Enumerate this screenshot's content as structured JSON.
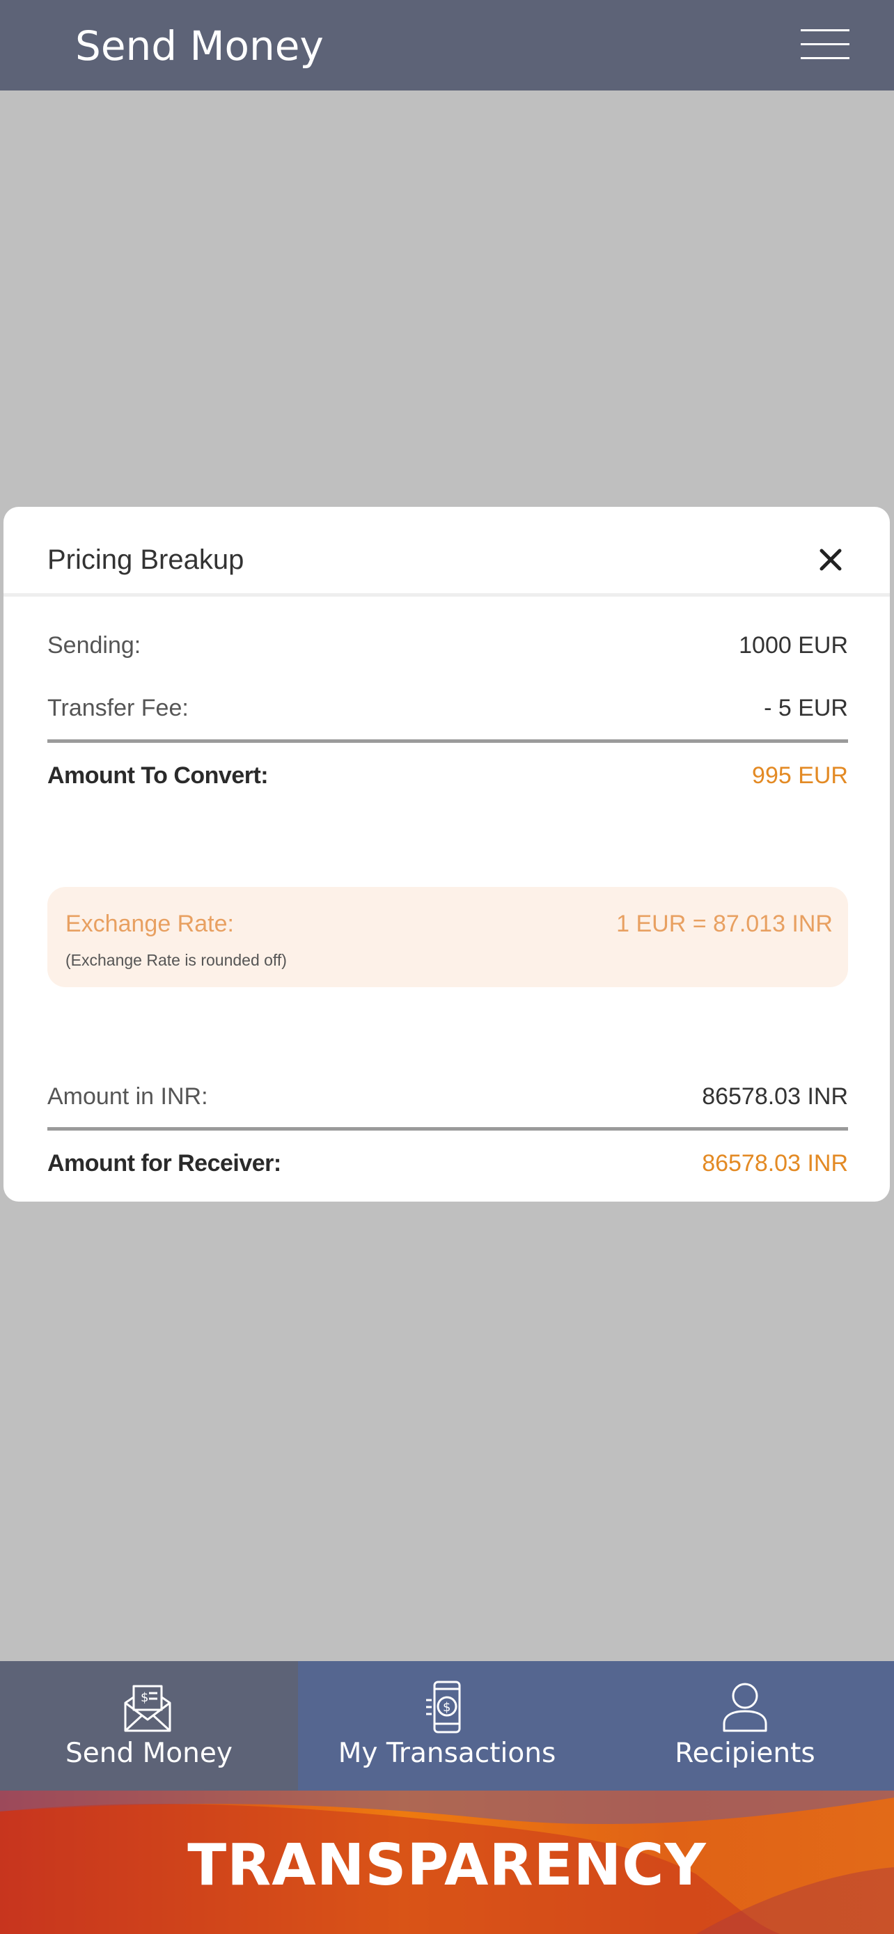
{
  "header": {
    "title": "Send Money",
    "menu_icon": "hamburger-menu-icon"
  },
  "modal": {
    "title": "Pricing Breakup",
    "close_icon": "close-icon",
    "rows": {
      "sending_label": "Sending:",
      "sending_value": "1000 EUR",
      "fee_label": "Transfer Fee:",
      "fee_value": "- 5 EUR",
      "convert_label": "Amount To Convert:",
      "convert_value": "995 EUR",
      "inr_label": "Amount in INR:",
      "inr_value": "86578.03 INR",
      "receiver_label": "Amount for Receiver:",
      "receiver_value": "86578.03 INR"
    },
    "exchange": {
      "label": "Exchange Rate:",
      "note": "(Exchange Rate is rounded off)",
      "value": "1 EUR = 87.013 INR"
    }
  },
  "bottom_nav": {
    "items": [
      {
        "label": "Send Money",
        "icon": "envelope-money-icon",
        "active": true
      },
      {
        "label": "My Transactions",
        "icon": "phone-dollar-icon",
        "active": false
      },
      {
        "label": "Recipients",
        "icon": "person-icon",
        "active": false
      }
    ]
  },
  "banner": {
    "text": "TRANSPARENCY"
  },
  "colors": {
    "header_bg": "#5d6377",
    "overlay_bg": "#bfbfbf",
    "accent_orange": "#e38a24",
    "nav_bg": "#556690",
    "nav_active_bg": "#5d6377",
    "banner_red": "#c7341c",
    "banner_orange": "#ee7a10"
  }
}
